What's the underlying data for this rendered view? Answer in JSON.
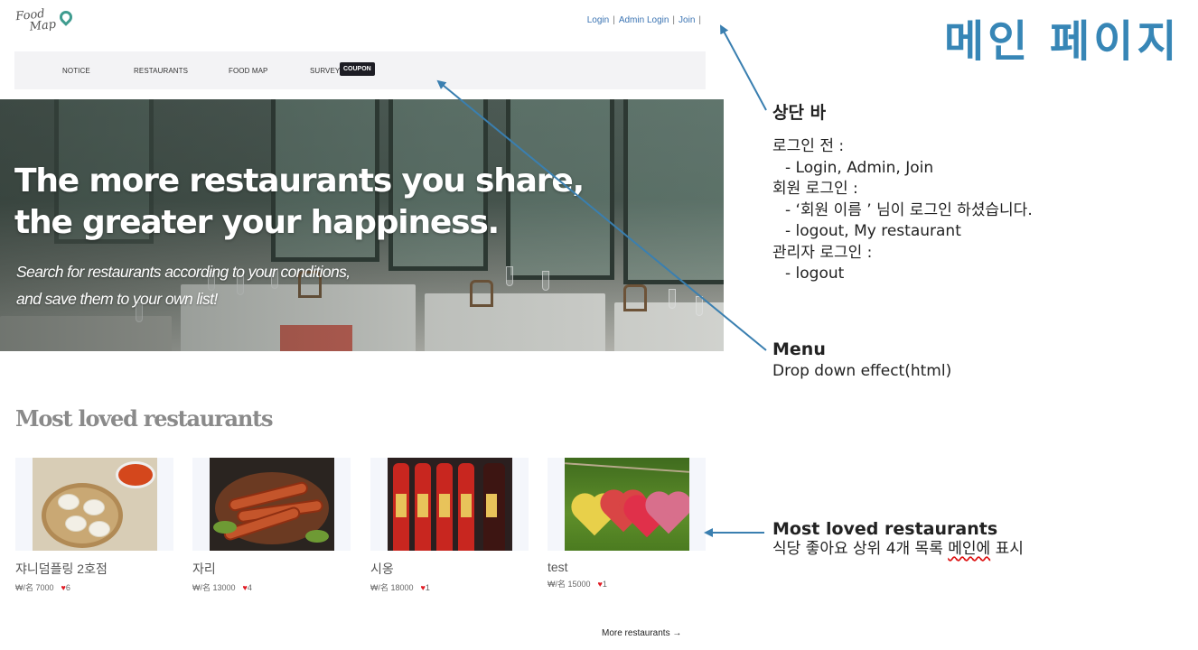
{
  "site": {
    "logo": {
      "line1": "Food",
      "line2": "Map"
    },
    "top_links": [
      "Login",
      "Admin Login",
      "Join"
    ],
    "top_links_trailing_sep": "|",
    "menu": [
      "NOTICE",
      "RESTAURANTS",
      "FOOD MAP",
      "SURVEY"
    ],
    "coupon_badge": "COUPON",
    "hero": {
      "title_line1": "The more restaurants you share,",
      "title_line2": "the greater your happiness.",
      "subtitle_line1": "Search for restaurants according to your conditions,",
      "subtitle_line2": "and save them to your own list!"
    },
    "section_title": "Most loved restaurants",
    "cards": [
      {
        "name": "쟈니덤플링 2호점",
        "price": "₩/名 7000",
        "likes": "6"
      },
      {
        "name": "자리",
        "price": "₩/名 13000",
        "likes": "4"
      },
      {
        "name": "시옹",
        "price": "₩/名 18000",
        "likes": "1"
      },
      {
        "name": "test",
        "price": "₩/名 15000",
        "likes": "1"
      }
    ],
    "heart_icon": "♥",
    "more_link": "More restaurants →"
  },
  "annotations": {
    "page_heading": "메인 페이지",
    "top_bar": {
      "title": "상단 바",
      "lines": [
        {
          "text": "로그인 전 :",
          "indent": false
        },
        {
          "text": "- Login, Admin, Join",
          "indent": true
        },
        {
          "text": "회원 로그인 :",
          "indent": false
        },
        {
          "text": "- ‘회원 이름 ’  님이 로그인 하셨습니다.",
          "indent": true
        },
        {
          "text": "- logout, My restaurant",
          "indent": true
        },
        {
          "text": "관리자 로그인 :",
          "indent": false
        },
        {
          "text": "- logout",
          "indent": true
        }
      ]
    },
    "menu": {
      "title": "Menu",
      "desc": "Drop down effect(html)"
    },
    "most_loved": {
      "title": "Most loved restaurants",
      "desc_part1": "식당 좋아요 상위 4개 목록 ",
      "desc_underlined": "메인에",
      "desc_part2": " 표시"
    }
  },
  "colors": {
    "heading_blue": "#3786b6",
    "arrow_blue": "#3a7fb0",
    "link_blue": "#3b74b3",
    "heart_red": "#e01b24"
  }
}
